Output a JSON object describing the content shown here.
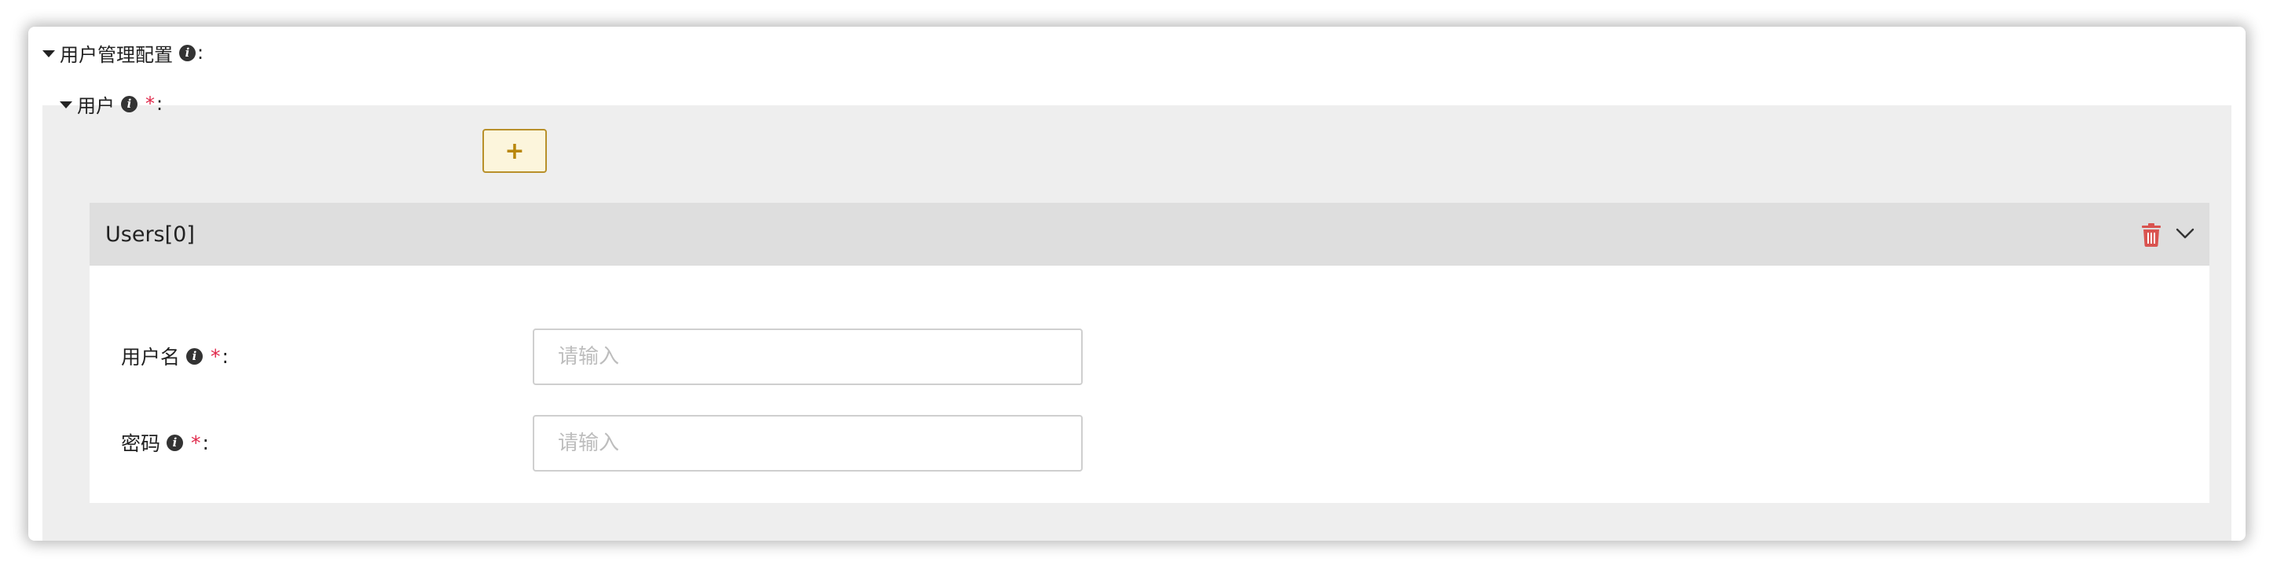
{
  "section": {
    "title": "用户管理配置",
    "colon": ":"
  },
  "users_group": {
    "label": "用户",
    "required_mark": "*",
    "colon": ":",
    "add_label": "+"
  },
  "items": [
    {
      "title": "Users[0]",
      "fields": [
        {
          "label": "用户名",
          "required_mark": "*",
          "colon": ":",
          "value": "",
          "placeholder": "请输入"
        },
        {
          "label": "密码",
          "required_mark": "*",
          "colon": ":",
          "value": "",
          "placeholder": "请输入"
        }
      ]
    }
  ],
  "icons": {
    "info": "info-circle-icon",
    "delete": "trash-icon",
    "collapse": "chevron-down-icon",
    "expand_caret": "caret-down-icon"
  },
  "colors": {
    "required": "#e0294b",
    "add_button_border": "#b8902a",
    "add_button_bg": "#fcf5dc",
    "delete_icon": "#d9534f",
    "panel_bg": "#eeeeee",
    "item_header_bg": "#dedede"
  }
}
